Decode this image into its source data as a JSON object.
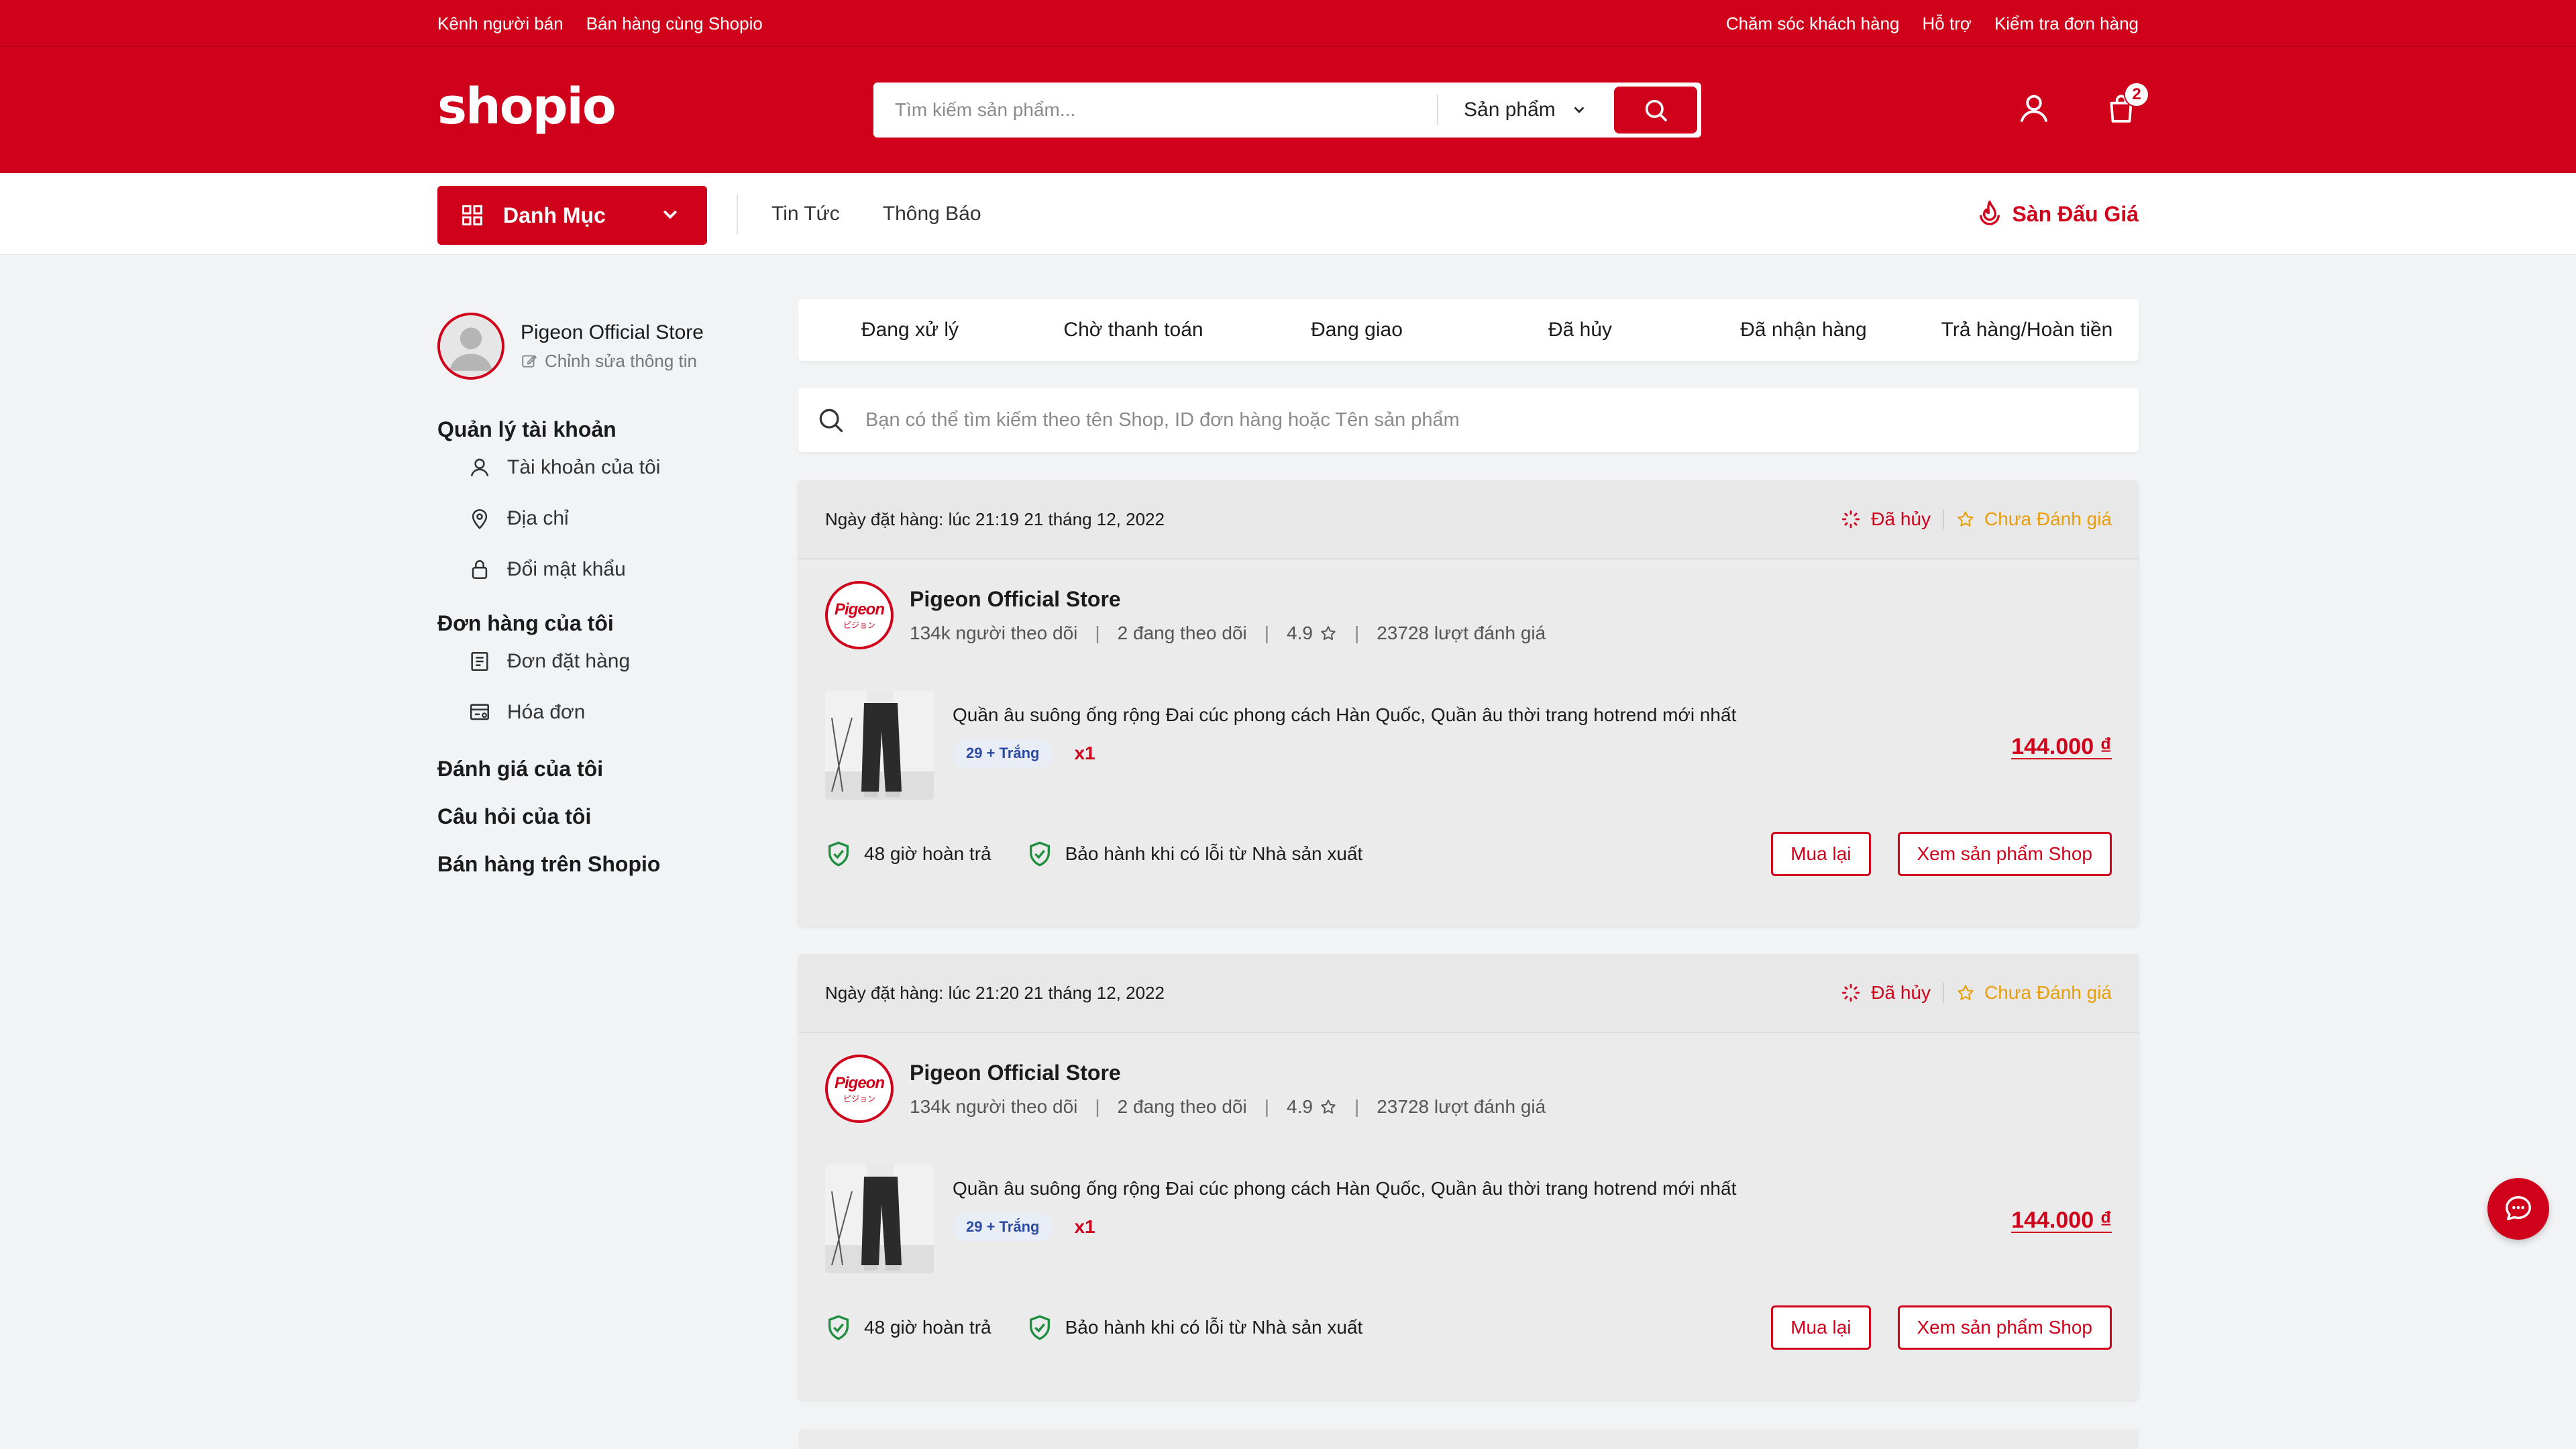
{
  "topbar": {
    "left_links": [
      "Kênh người bán",
      "Bán hàng cùng Shopio"
    ],
    "right_links": [
      "Chăm sóc khách hàng",
      "Hỗ trợ",
      "Kiểm tra đơn hàng"
    ]
  },
  "header": {
    "logo": "shopio",
    "search_placeholder": "Tìm kiếm sản phẩm...",
    "search_scope": "Sản phẩm",
    "cart_count": "2"
  },
  "nav": {
    "category_label": "Danh Mục",
    "links": [
      "Tin Tức",
      "Thông Báo"
    ],
    "auction_label": "Sàn Đấu Giá"
  },
  "sidebar": {
    "store_name": "Pigeon Official Store",
    "edit_label": "Chỉnh sửa thông tin",
    "account_title": "Quản lý tài khoản",
    "account_items": [
      "Tài khoản của tôi",
      "Địa chỉ",
      "Đổi mật khẩu"
    ],
    "orders_title": "Đơn hàng của tôi",
    "order_items": [
      "Đơn đặt hàng",
      "Hóa đơn"
    ],
    "reviews": "Đánh giá của tôi",
    "questions": "Câu hỏi của tôi",
    "sell": "Bán hàng trên Shopio"
  },
  "tabs": [
    "Đang xử lý",
    "Chờ thanh toán",
    "Đang giao",
    "Đã hủy",
    "Đã nhận hàng",
    "Trả hàng/Hoàn tiền"
  ],
  "order_search_placeholder": "Bạn có thể tìm kiếm theo tên Shop, ID đơn hàng hoặc Tên sản phẩm",
  "orders": [
    {
      "date": "Ngày đặt hàng: lúc 21:19 21 tháng 12, 2022",
      "status": "Đã hủy",
      "review_status": "Chưa Đánh giá",
      "shop_name": "Pigeon Official Store",
      "shop_logo_text": "Pigeon",
      "followers": "134k người theo dõi",
      "following": "2 đang theo dõi",
      "rating": "4.9",
      "reviews": "23728 lượt đánh giá",
      "product_title": "Quần âu suông ống rộng Đai cúc phong cách Hàn Quốc, Quần âu thời trang hotrend mới nhất",
      "variant": "29 + Trắng",
      "qty": "x1",
      "price": "144.000 ₫",
      "guarantee_1": "48 giờ hoàn trả",
      "guarantee_2": "Bảo hành khi có lỗi từ Nhà sản xuất",
      "btn_rebuy": "Mua lại",
      "btn_view": "Xem sản phẩm Shop"
    },
    {
      "date": "Ngày đặt hàng: lúc 21:20 21 tháng 12, 2022",
      "status": "Đã hủy",
      "review_status": "Chưa Đánh giá",
      "shop_name": "Pigeon Official Store",
      "shop_logo_text": "Pigeon",
      "followers": "134k người theo dõi",
      "following": "2 đang theo dõi",
      "rating": "4.9",
      "reviews": "23728 lượt đánh giá",
      "product_title": "Quần âu suông ống rộng Đai cúc phong cách Hàn Quốc, Quần âu thời trang hotrend mới nhất",
      "variant": "29 + Trắng",
      "qty": "x1",
      "price": "144.000 ₫",
      "guarantee_1": "48 giờ hoàn trả",
      "guarantee_2": "Bảo hành khi có lỗi từ Nhà sản xuất",
      "btn_rebuy": "Mua lại",
      "btn_view": "Xem sản phẩm Shop"
    }
  ],
  "colors": {
    "brand": "#d0011b",
    "review": "#e89d0a",
    "shield": "#1e8e3e"
  }
}
